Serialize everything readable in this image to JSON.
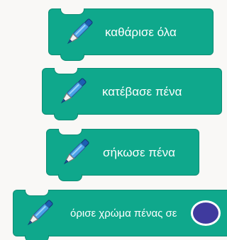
{
  "colors": {
    "block_fill": "#0fa88c",
    "block_border": "#0b8c73",
    "label_text": "#ffffff",
    "pen_color_value": "#3f3a9e"
  },
  "blocks": [
    {
      "label": "καθάρισε όλα",
      "icon": "pen-icon"
    },
    {
      "label": "κατέβασε πένα",
      "icon": "pen-icon"
    },
    {
      "label": "σήκωσε πένα",
      "icon": "pen-icon"
    },
    {
      "label": "όρισε χρώμα πένας σε",
      "icon": "pen-icon",
      "input": "color-swatch"
    }
  ]
}
